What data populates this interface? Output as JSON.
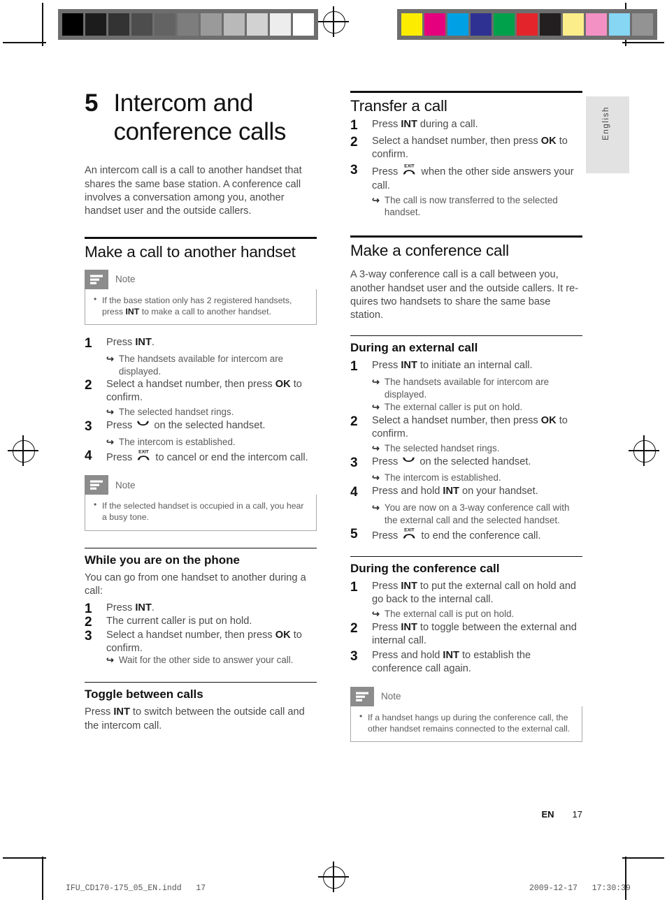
{
  "prepress": {
    "gray_wedge": [
      "#000000",
      "#1c1c1c",
      "#333333",
      "#4d4d4d",
      "#636363",
      "#7d7d7d",
      "#9a9a9a",
      "#b9b9b9",
      "#d2d2d2",
      "#ededed",
      "#ffffff"
    ],
    "color_bar": [
      "#fced00",
      "#e5007d",
      "#00a0e4",
      "#2e3192",
      "#00a14b",
      "#e3242b",
      "#231f20",
      "#fbee8a",
      "#f491c4",
      "#86d6f4",
      "#939393"
    ],
    "file_name": "IFU_CD170-175_05_EN.indd",
    "file_page": "17",
    "timestamp_date": "2009-12-17",
    "timestamp_time": "17:30:39"
  },
  "side_tab": {
    "label": "English"
  },
  "chapter": {
    "number": "5",
    "title_line1": "Intercom and",
    "title_line2": "conference calls",
    "intro": "An intercom call is a call to another handset that shares the same base station. A conference call involves a conversation among you, another handset user and the outside callers."
  },
  "left": {
    "section1": {
      "heading": "Make a call to another handset",
      "note1": {
        "label": "Note",
        "items_pre": [
          "If the base station only has 2 registered handsets, press "
        ],
        "bold": "INT",
        "items_post": [
          " to make a call to another handset."
        ]
      },
      "steps": [
        {
          "num": "1",
          "pre": "Press ",
          "bold": "INT",
          "post": ".",
          "results": [
            "The handsets available for intercom are displayed."
          ]
        },
        {
          "num": "2",
          "pre": "Select a handset number, then press ",
          "bold": "OK",
          "post": " to confirm.",
          "results": [
            "The selected handset rings."
          ]
        },
        {
          "num": "3",
          "pre": "Press ",
          "icon": "talk-icon",
          "post": " on the selected handset.",
          "results": [
            "The intercom is established."
          ]
        },
        {
          "num": "4",
          "pre": "Press ",
          "icon": "exit-icon",
          "post": " to cancel or end the intercom call.",
          "results": []
        }
      ],
      "note2": {
        "label": "Note",
        "text": "If the selected handset is occupied in a call, you hear a busy tone."
      }
    },
    "section2": {
      "heading": "While you are on the phone",
      "intro": "You can go from one handset to another during a call:",
      "steps": [
        {
          "num": "1",
          "pre": "Press ",
          "bold": "INT",
          "post": ".",
          "results": []
        },
        {
          "num": "2",
          "pre": "The current caller is put on hold.",
          "bold": "",
          "post": "",
          "results": []
        },
        {
          "num": "3",
          "pre": "Select a handset number, then press ",
          "bold": "OK",
          "post": " to confirm.",
          "results": [
            "Wait for the other side to answer your call."
          ]
        }
      ]
    },
    "section3": {
      "heading": "Toggle between calls",
      "pre": "Press ",
      "bold": "INT",
      "post": " to switch between the outside call and the intercom call."
    }
  },
  "right": {
    "section1": {
      "heading": "Transfer a call",
      "steps": [
        {
          "num": "1",
          "pre": "Press ",
          "bold": "INT",
          "post": " during a call.",
          "results": []
        },
        {
          "num": "2",
          "pre": "Select a handset number, then press ",
          "bold": "OK",
          "post": " to confirm.",
          "results": []
        },
        {
          "num": "3",
          "pre": "Press ",
          "icon": "exit-icon",
          "post": " when the other side answers your call.",
          "results": [
            "The call is now transferred to the selected handset."
          ]
        }
      ]
    },
    "section2": {
      "heading": "Make a conference call",
      "intro": "A 3-way conference call is a call between you, another handset user and the outside callers. It re-quires two handsets to share the same base station.",
      "sub1": {
        "heading": "During an external call",
        "steps": [
          {
            "num": "1",
            "pre": "Press ",
            "bold": "INT",
            "post": " to initiate an internal call.",
            "results": [
              "The handsets available for intercom are displayed.",
              "The external caller is put on hold."
            ]
          },
          {
            "num": "2",
            "pre": "Select a handset number, then press ",
            "bold": "OK",
            "post": " to confirm.",
            "results": [
              "The selected handset rings."
            ]
          },
          {
            "num": "3",
            "pre": "Press ",
            "icon": "talk-icon",
            "post": " on the selected handset.",
            "results": [
              "The intercom is established."
            ]
          },
          {
            "num": "4",
            "pre": "Press and hold ",
            "bold": "INT",
            "post": " on your handset.",
            "results": [
              "You are now on a 3-way conference call with the external call and the selected handset."
            ]
          },
          {
            "num": "5",
            "pre": "Press ",
            "icon": "exit-icon",
            "post": " to end the conference call.",
            "results": []
          }
        ]
      },
      "sub2": {
        "heading": "During the conference call",
        "steps": [
          {
            "num": "1",
            "pre": "Press ",
            "bold": "INT",
            "post": " to put the external call on hold and go back to the internal call.",
            "results": [
              "The external call is put on hold."
            ]
          },
          {
            "num": "2",
            "pre": "Press ",
            "bold": "INT",
            "post": " to toggle between the external and internal call.",
            "results": []
          },
          {
            "num": "3",
            "pre": "Press and hold ",
            "bold": "INT",
            "post": " to establish the conference call again.",
            "results": []
          }
        ]
      },
      "note": {
        "label": "Note",
        "text": "If a handset hangs up during the conference call, the other handset remains connected to the external call."
      }
    }
  },
  "footer": {
    "lang_code": "EN",
    "page_number": "17"
  }
}
